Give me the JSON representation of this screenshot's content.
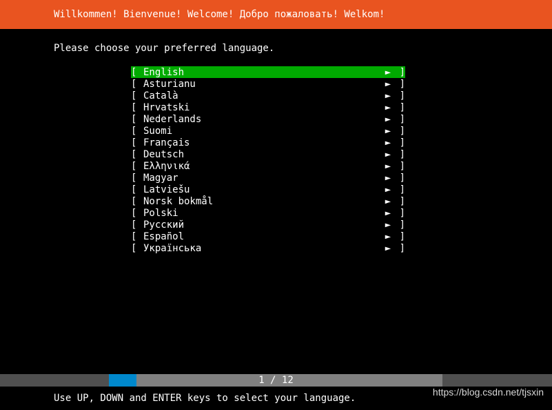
{
  "header": {
    "title": "Willkommen! Bienvenue! Welcome! Добро пожаловать! Welkom!"
  },
  "prompt": "Please choose your preferred language.",
  "languages": [
    {
      "name": "English",
      "selected": true
    },
    {
      "name": "Asturianu",
      "selected": false
    },
    {
      "name": "Català",
      "selected": false
    },
    {
      "name": "Hrvatski",
      "selected": false
    },
    {
      "name": "Nederlands",
      "selected": false
    },
    {
      "name": "Suomi",
      "selected": false
    },
    {
      "name": "Français",
      "selected": false
    },
    {
      "name": "Deutsch",
      "selected": false
    },
    {
      "name": "Ελληνικά",
      "selected": false
    },
    {
      "name": "Magyar",
      "selected": false
    },
    {
      "name": "Latviešu",
      "selected": false
    },
    {
      "name": "Norsk bokmål",
      "selected": false
    },
    {
      "name": "Polski",
      "selected": false
    },
    {
      "name": "Русский",
      "selected": false
    },
    {
      "name": "Español",
      "selected": false
    },
    {
      "name": "Українська",
      "selected": false
    }
  ],
  "brackets": {
    "left": "[ ",
    "right": " ]",
    "arrow": "►"
  },
  "progress": {
    "label": "1 / 12"
  },
  "hint": "Use UP, DOWN and ENTER keys to select your language.",
  "watermark": "https://blog.csdn.net/tjsxin"
}
